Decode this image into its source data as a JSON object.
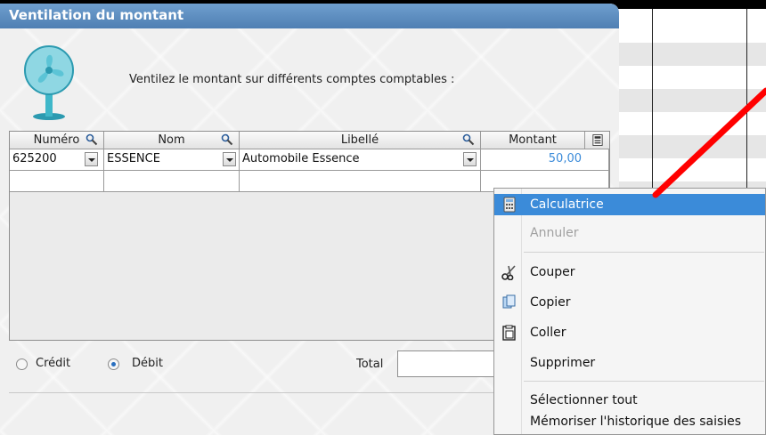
{
  "dialog": {
    "title": "Ventilation du montant",
    "instruction": "Ventilez le montant sur différents comptes comptables :"
  },
  "grid": {
    "columns": [
      "Numéro",
      "Nom",
      "Libellé",
      "Montant"
    ],
    "rows": [
      {
        "numero": "625200",
        "nom": "ESSENCE",
        "libelle": "Automobile Essence",
        "montant": "50,00"
      }
    ]
  },
  "options": {
    "credit": "Crédit",
    "debit": "Débit",
    "selected": "debit",
    "total_label": "Total"
  },
  "context_menu": {
    "items": [
      {
        "label": "Calculatrice",
        "state": "highlighted",
        "icon": "calculator-icon"
      },
      {
        "label": "Annuler",
        "state": "disabled"
      },
      {
        "label": "Couper",
        "icon": "scissors-icon"
      },
      {
        "label": "Copier",
        "icon": "copy-icon"
      },
      {
        "label": "Coller",
        "icon": "paste-icon"
      },
      {
        "label": "Supprimer"
      },
      {
        "label": "Sélectionner tout"
      },
      {
        "label": "Mémoriser l'historique des saisies"
      }
    ]
  },
  "colors": {
    "title_bar": "#5b8bc0",
    "menu_highlight": "#3b8bd9",
    "annotation_arrow": "#ff0000"
  }
}
